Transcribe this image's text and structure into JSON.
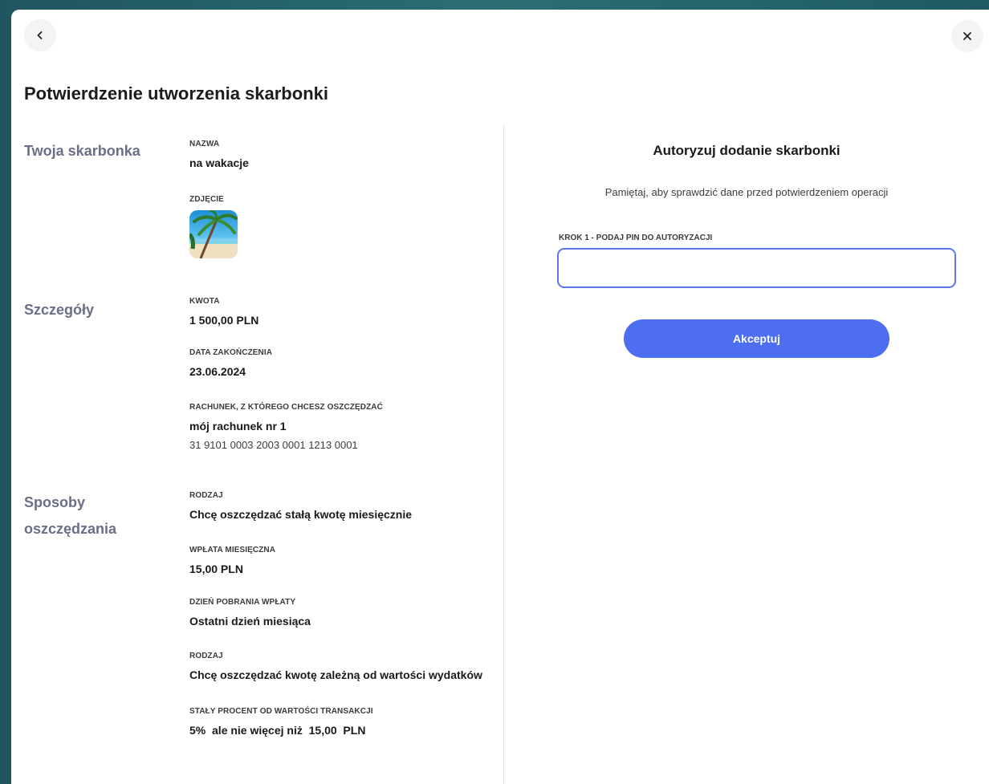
{
  "header": {
    "back_icon": "chevron-left-icon",
    "close_icon": "close-icon",
    "title": "Potwierdzenie utworzenia skarbonki"
  },
  "left": {
    "sections": {
      "twoja": "Twoja skarbonka",
      "szczegoly": "Szczegóły",
      "sposoby_line1": "Sposoby",
      "sposoby_line2": "oszczędzania"
    },
    "nazwa": {
      "label": "NAZWA",
      "value": "na wakacje"
    },
    "zdjecie": {
      "label": "ZDJĘCIE"
    },
    "kwota": {
      "label": "KWOTA",
      "value": "1 500,00 PLN"
    },
    "data_zakonczenia": {
      "label": "DATA ZAKOŃCZENIA",
      "value": "23.06.2024"
    },
    "rachunek": {
      "label": "RACHUNEK, Z KTÓREGO CHCESZ OSZCZĘDZAĆ",
      "value": "mój rachunek nr 1",
      "number": "31 9101 0003 2003 0001 1213 0001"
    },
    "rodzaj1": {
      "label": "RODZAJ",
      "value": "Chcę oszczędzać stałą kwotę miesięcznie"
    },
    "wplata": {
      "label": "WPŁATA MIESIĘCZNA",
      "value": "15,00 PLN"
    },
    "dzien": {
      "label": "DZIEŃ POBRANIA WPŁATY",
      "value": "Ostatni dzień miesiąca"
    },
    "rodzaj2": {
      "label": "RODZAJ",
      "value": "Chcę oszczędzać kwotę zależną od wartości wydatków"
    },
    "procent": {
      "label": "STAŁY PROCENT OD WARTOŚCI TRANSAKCJI",
      "value": "5%  ale nie więcej niż  15,00  PLN"
    }
  },
  "auth": {
    "title": "Autoryzuj dodanie skarbonki",
    "subtitle": "Pamiętaj, aby sprawdzić dane przed potwierdzeniem operacji",
    "pin_label": "KROK 1 - PODAJ PIN DO AUTORYZACJI",
    "pin_value": "",
    "accept_label": "Akceptuj"
  },
  "colors": {
    "accent": "#4e6ef2",
    "section_title": "#6b6f86",
    "input_border": "#5a78e8"
  }
}
